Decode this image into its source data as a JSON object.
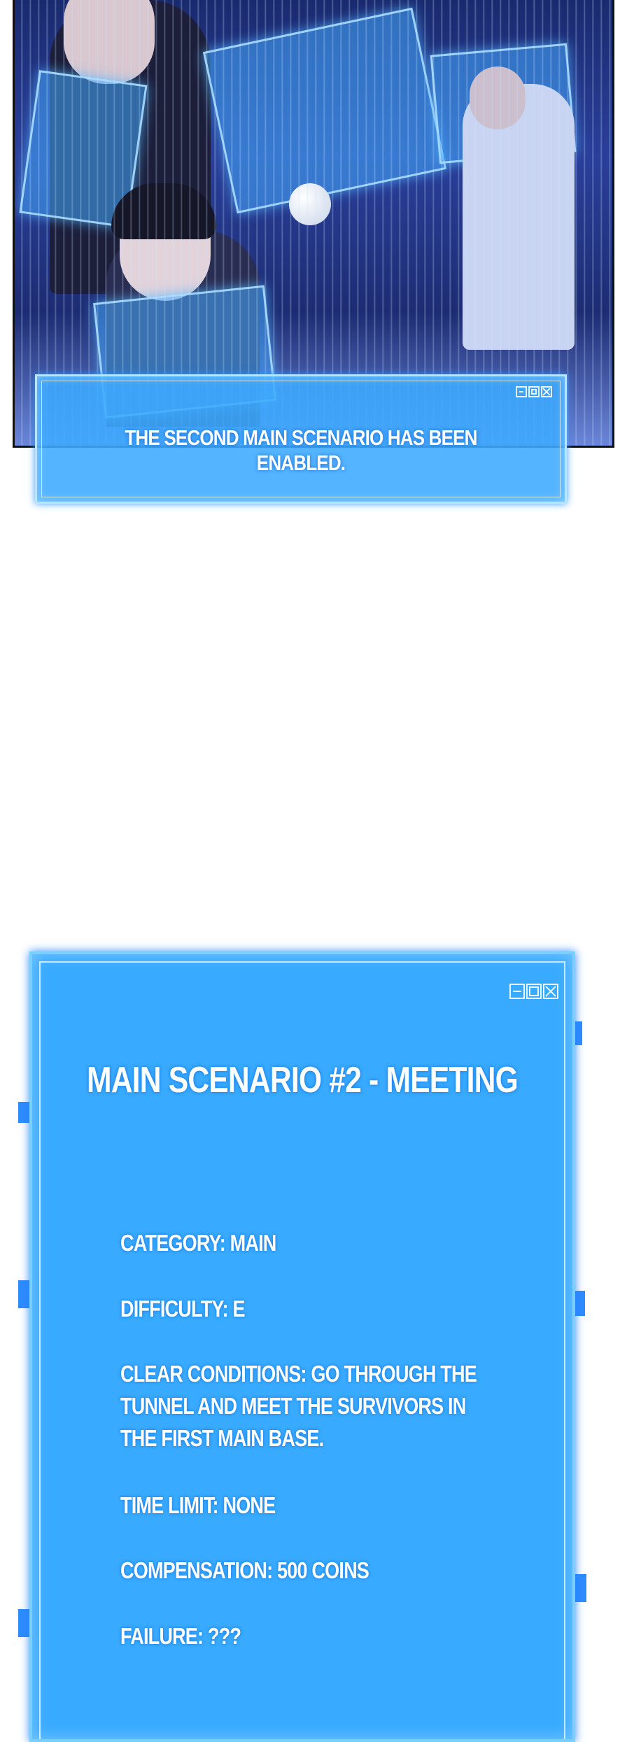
{
  "panel": {
    "description_icon": "comic-illustration"
  },
  "notice": {
    "text": "THE SECOND MAIN SCENARIO HAS BEEN ENABLED."
  },
  "scenario": {
    "title": "MAIN SCENARIO #2 - MEETING",
    "category": "CATEGORY: MAIN",
    "difficulty": "DIFFICULTY: E",
    "clear_conditions": "CLEAR CONDITIONS: GO THROUGH THE TUNNEL AND MEET THE SURVIVORS IN THE FIRST MAIN BASE.",
    "time_limit": "TIME LIMIT: NONE",
    "compensation": "COMPENSATION: 500 COINS",
    "failure": "FAILURE: ???"
  },
  "colors": {
    "window_blue": "#38aaff",
    "window_border": "#7bcfff",
    "text": "#ffffff"
  }
}
